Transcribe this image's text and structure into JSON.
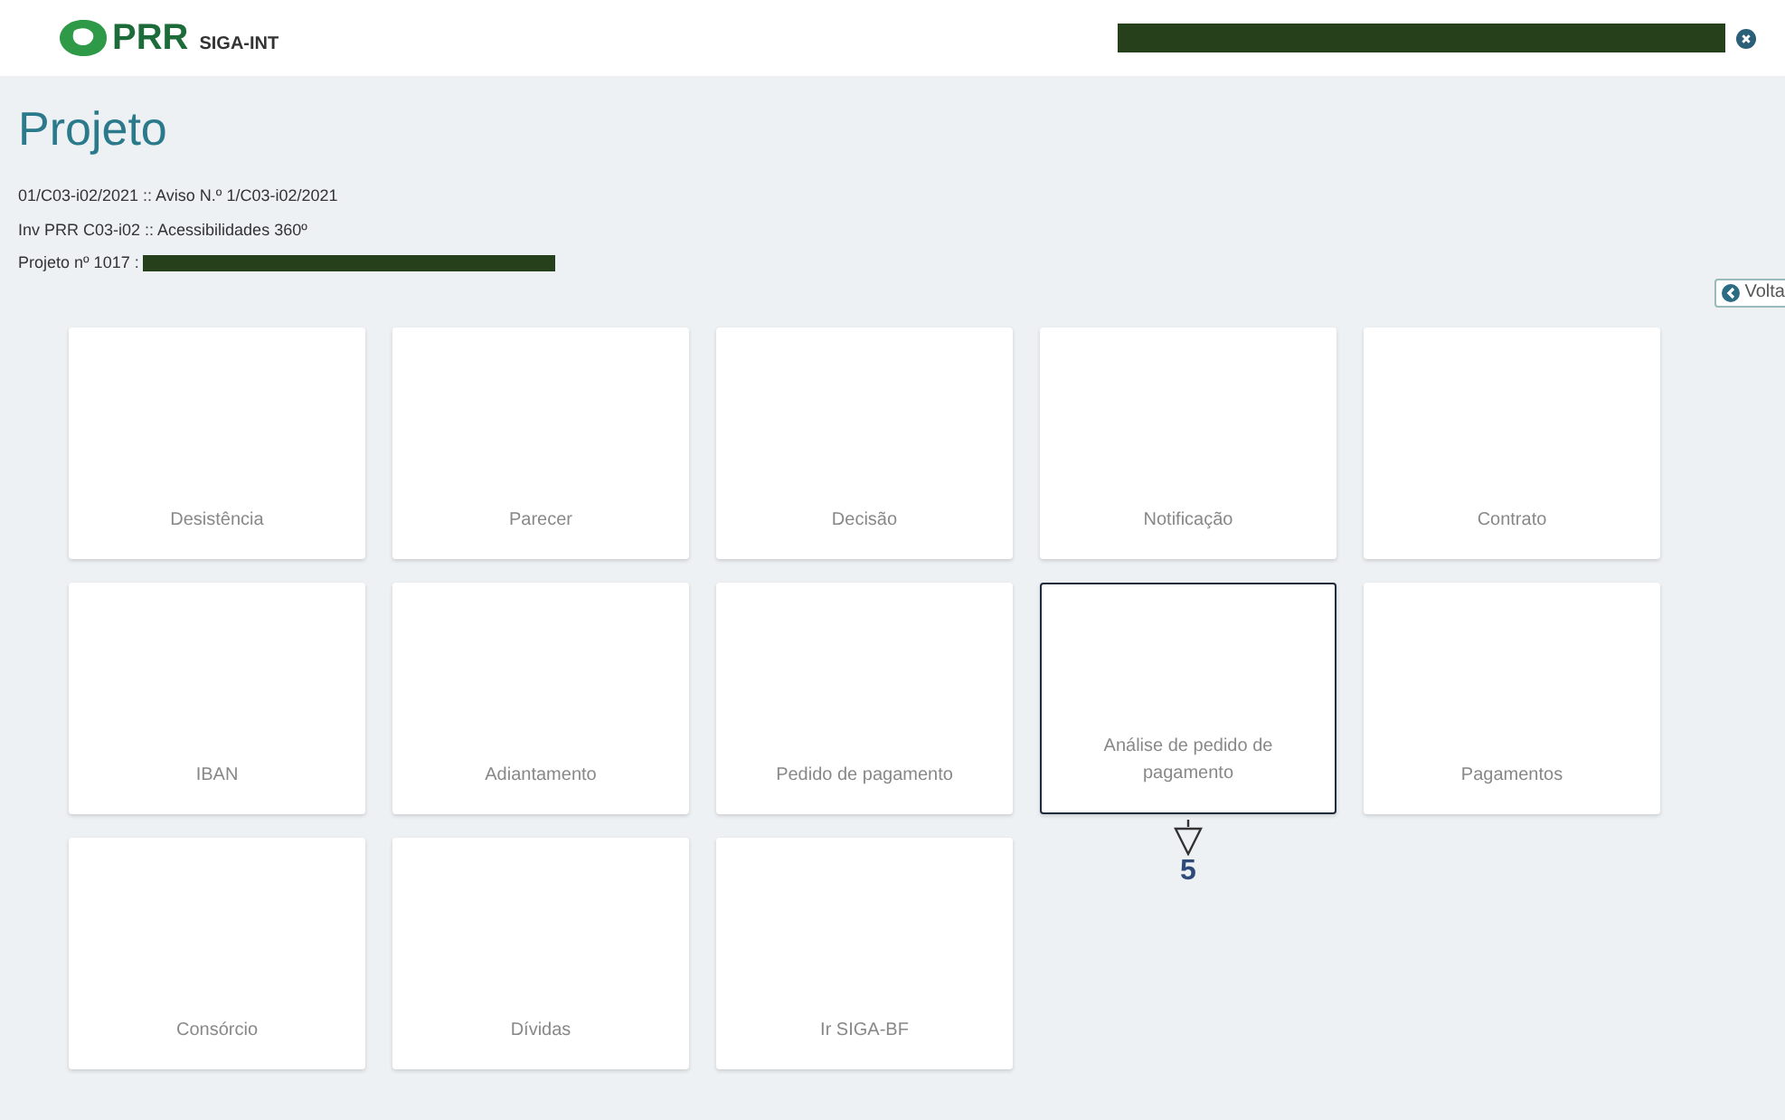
{
  "header": {
    "logo_text": "PRR",
    "app_name": "SIGA-INT"
  },
  "page": {
    "title": "Projeto",
    "info_lines": [
      "01/C03-i02/2021 :: Aviso N.º 1/C03-i02/2021",
      "Inv PRR C03-i02 :: Acessibilidades 360º",
      "Projeto nº 1017 :"
    ],
    "back_button": "Volta"
  },
  "tiles": [
    {
      "label": "Desistência",
      "selected": false
    },
    {
      "label": "Parecer",
      "selected": false
    },
    {
      "label": "Decisão",
      "selected": false
    },
    {
      "label": "Notificação",
      "selected": false
    },
    {
      "label": "Contrato",
      "selected": false
    },
    {
      "label": "IBAN",
      "selected": false
    },
    {
      "label": "Adiantamento",
      "selected": false
    },
    {
      "label": "Pedido de pagamento",
      "selected": false
    },
    {
      "label": "Análise de pedido de pagamento",
      "selected": true,
      "callout": "5"
    },
    {
      "label": "Pagamentos",
      "selected": false
    },
    {
      "label": "Consórcio",
      "selected": false
    },
    {
      "label": "Dívidas",
      "selected": false
    },
    {
      "label": "Ir SIGA-BF",
      "selected": false
    }
  ]
}
